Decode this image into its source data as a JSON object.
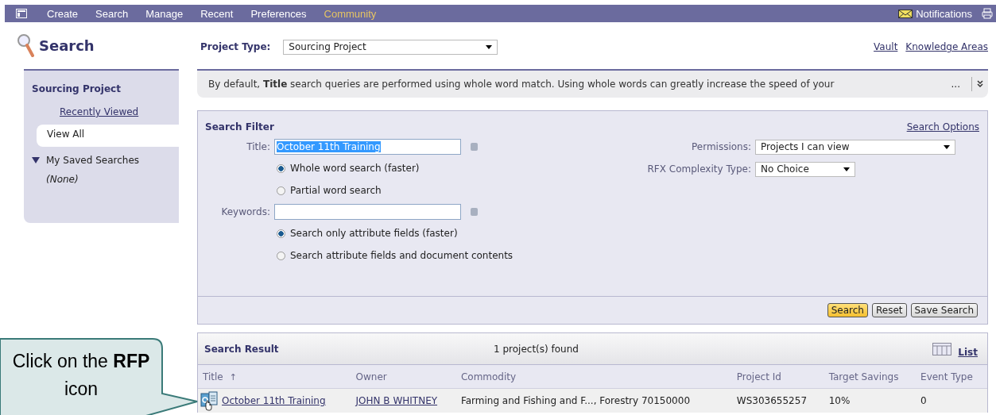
{
  "nav": {
    "items": [
      {
        "label": "Create",
        "selected": false
      },
      {
        "label": "Search",
        "selected": false
      },
      {
        "label": "Manage",
        "selected": false
      },
      {
        "label": "Recent",
        "selected": false
      },
      {
        "label": "Preferences",
        "selected": false
      },
      {
        "label": "Community",
        "selected": true
      }
    ],
    "notifications": "Notifications"
  },
  "page_title": "Search",
  "sidebar": {
    "heading": "Sourcing Project",
    "items": [
      {
        "label": "Recently Viewed",
        "selected": false
      },
      {
        "label": "View All",
        "selected": true
      }
    ],
    "saved": {
      "label": "My Saved Searches",
      "expanded": true,
      "children": [
        {
          "label": "(None)"
        }
      ]
    }
  },
  "project_type": {
    "label": "Project Type:",
    "value": "Sourcing Project"
  },
  "links": [
    "Vault",
    "Knowledge Areas"
  ],
  "info_banner": {
    "text": "By default, **Title** search queries are performed using whole word match. Using whole words can greatly increase the speed of your",
    "more": "..."
  },
  "search_filter": {
    "title": "Search Filter",
    "options_link": "Search Options",
    "title_field": {
      "label": "Title:",
      "value": "October 11th Training",
      "text_selected": true
    },
    "title_modes": [
      {
        "label": "Whole word search (faster)",
        "selected": true
      },
      {
        "label": "Partial word search",
        "selected": false
      }
    ],
    "keywords_field": {
      "label": "Keywords:"
    },
    "keyword_modes": [
      {
        "label": "Search only attribute fields (faster)",
        "selected": true
      },
      {
        "label": "Search attribute fields and document contents",
        "selected": false
      }
    ],
    "permissions": {
      "label": "Permissions:",
      "value": "Projects I can view"
    },
    "complexity": {
      "label": "RFX Complexity Type:",
      "value": "No Choice"
    },
    "buttons": [
      {
        "label": "Search",
        "primary": true
      },
      {
        "label": "Reset",
        "primary": false
      },
      {
        "label": "Save Search",
        "primary": false
      }
    ]
  },
  "results": {
    "title": "Search Result",
    "count": "1 project(s) found",
    "view_link": "List",
    "columns": [
      {
        "label": "Title",
        "sort": "↑"
      },
      {
        "label": "Owner"
      },
      {
        "label": "Commodity"
      },
      {
        "label": "Project Id"
      },
      {
        "label": "Target Savings"
      },
      {
        "label": "Event Type"
      }
    ],
    "rows": [
      {
        "cells": [
          {
            "kind": "project-link",
            "text": "October 11th Training"
          },
          {
            "kind": "link",
            "text": "JOHN B WHITNEY"
          },
          {
            "kind": "text",
            "text": "Farming and Fishing and F..., Forestry 70150000"
          },
          {
            "kind": "text",
            "text": "WS303655257"
          },
          {
            "kind": "text",
            "text": "10%"
          },
          {
            "kind": "text",
            "text": "0"
          }
        ]
      }
    ]
  },
  "callout": {
    "text": "Click on the **RFP** icon"
  }
}
